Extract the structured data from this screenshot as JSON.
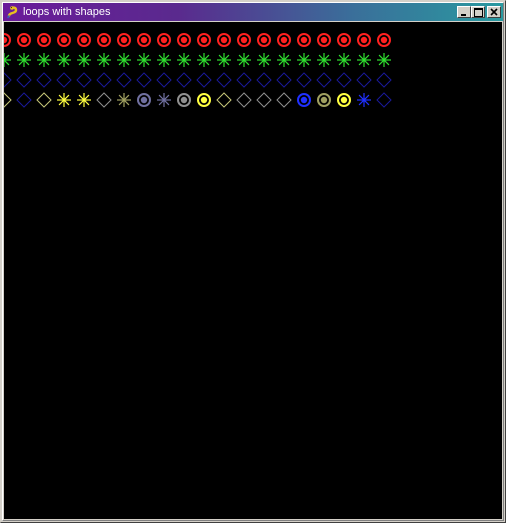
{
  "window": {
    "title": "loops with shapes",
    "icon": "snake-icon",
    "buttons": {
      "minimize": "minimize-icon",
      "maximize": "maximize-icon",
      "close": "close-icon"
    }
  },
  "colors": {
    "background": "#000000",
    "red": "#ff2020",
    "green": "#30e030",
    "dark_blue": "#1a1a9a",
    "blue": "#2030ff",
    "yellow": "#ffff40",
    "pale_yellow": "#e8e880",
    "olive": "#a0a060",
    "gray": "#909090",
    "slate": "#7070a0",
    "khaki": "#c8c878"
  },
  "shape_rows": [
    {
      "name": "red-target-row",
      "cells": [
        "target-red",
        "target-red",
        "target-red",
        "target-red",
        "target-red",
        "target-red",
        "target-red",
        "target-red",
        "target-red",
        "target-red",
        "target-red",
        "target-red",
        "target-red",
        "target-red",
        "target-red",
        "target-red",
        "target-red",
        "target-red",
        "target-red",
        "target-red"
      ]
    },
    {
      "name": "green-star-row",
      "cells": [
        "star-green",
        "star-green",
        "star-green",
        "star-green",
        "star-green",
        "star-green",
        "star-green",
        "star-green",
        "star-green",
        "star-green",
        "star-green",
        "star-green",
        "star-green",
        "star-green",
        "star-green",
        "star-green",
        "star-green",
        "star-green",
        "star-green",
        "star-green"
      ]
    },
    {
      "name": "blue-diamond-row",
      "cells": [
        "diamond-dark_blue",
        "diamond-dark_blue",
        "diamond-dark_blue",
        "diamond-dark_blue",
        "diamond-dark_blue",
        "diamond-dark_blue",
        "diamond-dark_blue",
        "diamond-dark_blue",
        "diamond-dark_blue",
        "diamond-dark_blue",
        "diamond-dark_blue",
        "diamond-dark_blue",
        "diamond-dark_blue",
        "diamond-dark_blue",
        "diamond-dark_blue",
        "diamond-dark_blue",
        "diamond-dark_blue",
        "diamond-dark_blue",
        "diamond-dark_blue",
        "diamond-dark_blue"
      ]
    },
    {
      "name": "mixed-shape-row",
      "cells": [
        "diamond-khaki",
        "diamond-dark_blue",
        "diamond-khaki",
        "star-yellow",
        "star-yellow",
        "diamond-gray",
        "star-olive",
        "target-slate",
        "star-slate",
        "target-gray",
        "target-yellow",
        "diamond-khaki",
        "diamond-gray",
        "diamond-gray",
        "diamond-gray",
        "target-blue",
        "target-olive",
        "target-yellow",
        "star-blue",
        "diamond-dark_blue"
      ]
    }
  ]
}
